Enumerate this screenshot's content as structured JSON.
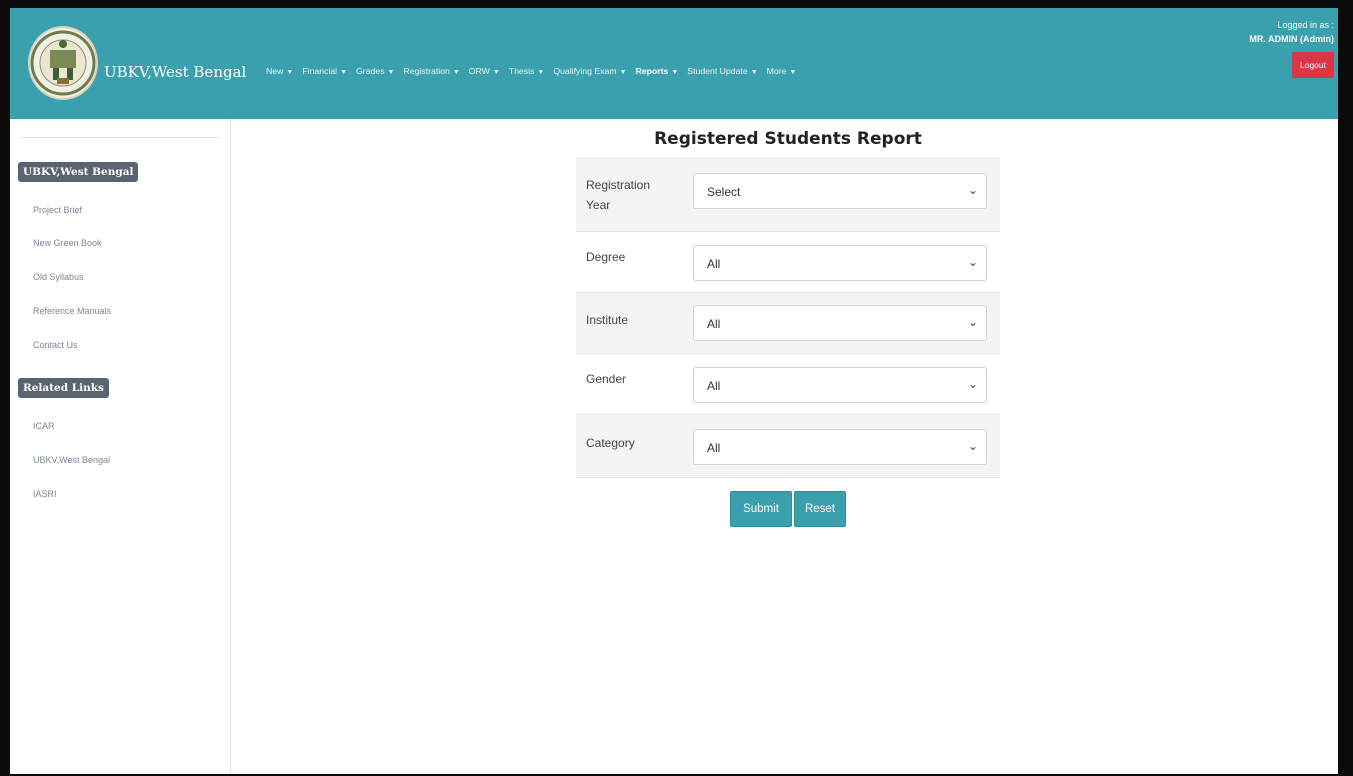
{
  "header": {
    "brand": "UBKV,West Bengal",
    "nav": [
      {
        "label": "New",
        "bold": false
      },
      {
        "label": "Financial",
        "bold": false
      },
      {
        "label": "Grades",
        "bold": false
      },
      {
        "label": "Registration",
        "bold": false
      },
      {
        "label": "ORW",
        "bold": false
      },
      {
        "label": "Thesis",
        "bold": false
      },
      {
        "label": "Qualifying Exam",
        "bold": false
      },
      {
        "label": "Reports",
        "bold": true
      },
      {
        "label": "Student Update",
        "bold": false
      },
      {
        "label": "More",
        "bold": false
      }
    ],
    "logged_in_label": "Logged in as :",
    "user": "MR. ADMIN (Admin)",
    "logout": "Logout",
    "colors": {
      "bar": "#3aa0ae",
      "logout": "#dc3545"
    }
  },
  "sidebar": {
    "section1_title": "UBKV,West Bengal",
    "section1_items": [
      "Project Brief",
      "New Green Book",
      "Old Syllabus",
      "Reference Manuals",
      "Contact Us"
    ],
    "section2_title": "Related Links",
    "section2_items": [
      "ICAR",
      "UBKV,West Bengal",
      "IASRI"
    ]
  },
  "main": {
    "title": "Registered Students Report",
    "fields": [
      {
        "label": "Registration Year",
        "value": "Select"
      },
      {
        "label": "Degree",
        "value": "All"
      },
      {
        "label": "Institute",
        "value": "All"
      },
      {
        "label": "Gender",
        "value": "All"
      },
      {
        "label": "Category",
        "value": "All"
      }
    ],
    "submit": "Submit",
    "reset": "Reset"
  }
}
